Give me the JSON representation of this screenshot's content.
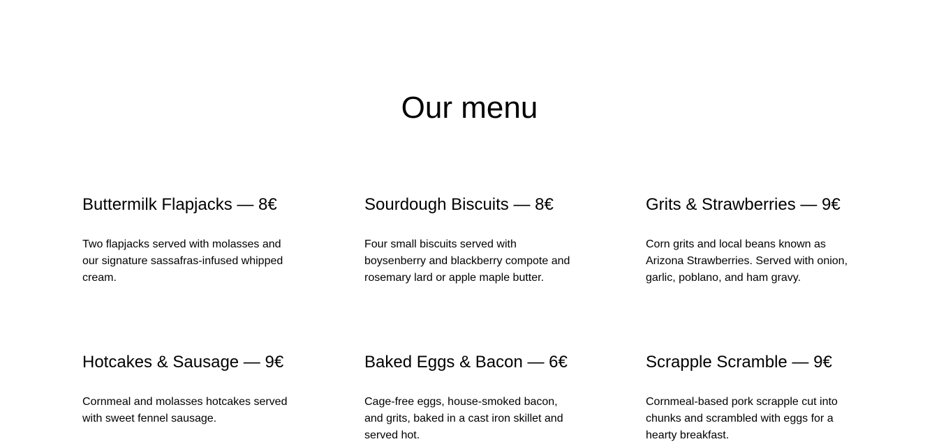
{
  "menu": {
    "title": "Our menu",
    "items": [
      {
        "heading": "Buttermilk Flapjacks — 8€",
        "description": "Two flapjacks served with molasses and our signature sassafras-infused whipped cream."
      },
      {
        "heading": "Sourdough Biscuits — 8€",
        "description": "Four small biscuits served with boysenberry and blackberry compote and rosemary lard or apple maple butter."
      },
      {
        "heading": "Grits & Strawberries — 9€",
        "description": "Corn grits and local beans known as Arizona Strawberries. Served with onion, garlic, poblano, and ham gravy."
      },
      {
        "heading": "Hotcakes & Sausage — 9€",
        "description": "Cornmeal and molasses hotcakes served with sweet fennel sausage."
      },
      {
        "heading": "Baked Eggs & Bacon — 6€",
        "description": "Cage-free eggs, house-smoked bacon, and grits, baked in a cast iron skillet and served hot."
      },
      {
        "heading": "Scrapple Scramble — 9€",
        "description": "Cornmeal-based pork scrapple cut into chunks and scrambled with eggs for a hearty breakfast."
      }
    ]
  }
}
